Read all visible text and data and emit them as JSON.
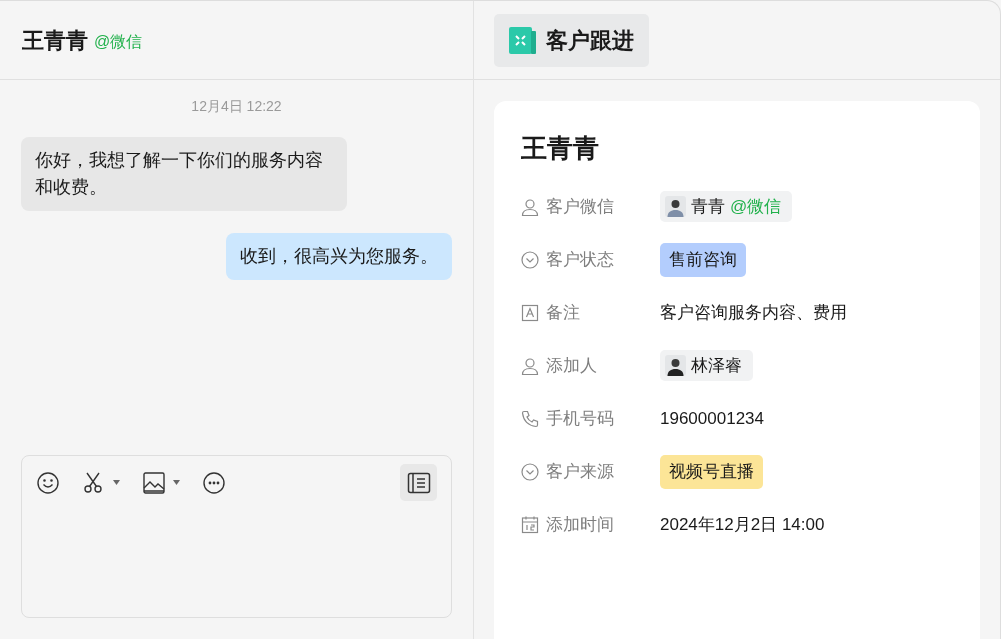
{
  "chat": {
    "contact_name": "王青青",
    "channel": "@微信",
    "timestamp": "12月4日 12:22",
    "messages": [
      {
        "kind": "incoming",
        "text": "你好，我想了解一下你们的服务内容和收费。"
      },
      {
        "kind": "outgoing",
        "text": "收到，很高兴为您服务。"
      }
    ]
  },
  "composer": {
    "tools": [
      {
        "kind": "emoji",
        "dropdown": false
      },
      {
        "kind": "scissors",
        "dropdown": true
      },
      {
        "kind": "image",
        "dropdown": true
      },
      {
        "kind": "more",
        "dropdown": false
      }
    ]
  },
  "panel": {
    "tab": "客户跟进",
    "customer_name": "王青青",
    "fields": [
      {
        "kind": "contact",
        "label": "客户微信",
        "name": "青青",
        "channel": "@微信"
      },
      {
        "kind": "select",
        "label": "客户状态",
        "value": "售前咨询",
        "color": "#b3cdfd"
      },
      {
        "kind": "note",
        "label": "备注",
        "value": "客户咨询服务内容、费用"
      },
      {
        "kind": "person",
        "label": "添加人",
        "name": "林泽睿"
      },
      {
        "kind": "phone",
        "label": "手机号码",
        "value": "19600001234"
      },
      {
        "kind": "select",
        "label": "客户来源",
        "value": "视频号直播",
        "color": "#fce597"
      },
      {
        "kind": "date",
        "label": "添加时间",
        "value": "2024年12月2日 14:00"
      }
    ]
  }
}
